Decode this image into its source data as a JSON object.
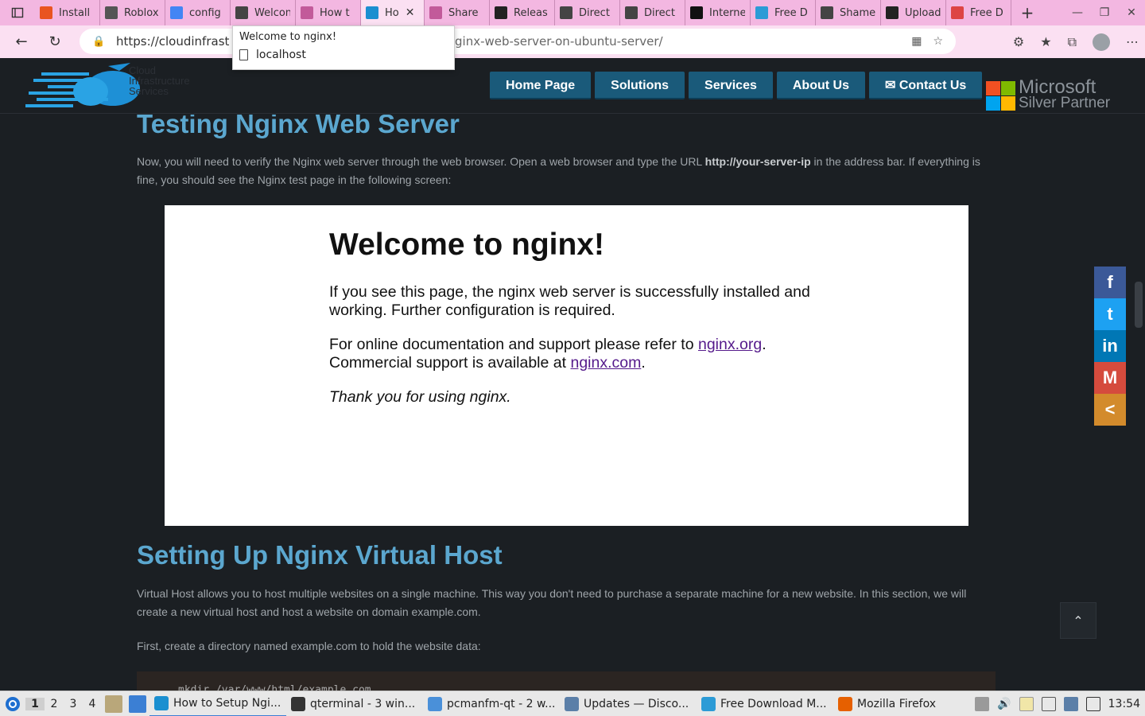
{
  "browser": {
    "tabs": [
      {
        "title": "Install",
        "icon": "ubuntu-icon",
        "color": "#e95420"
      },
      {
        "title": "Roblox",
        "icon": "roblox-icon",
        "color": "#555555"
      },
      {
        "title": "config",
        "icon": "google-icon",
        "color": "#4285f4"
      },
      {
        "title": "Welcon",
        "icon": "page-icon",
        "color": "#444444"
      },
      {
        "title": "How t",
        "icon": "site-icon",
        "color": "#c25a9a"
      },
      {
        "title": "Ho",
        "icon": "cloud-site-icon",
        "color": "#1a8fd0",
        "active": true
      },
      {
        "title": "Share",
        "icon": "site-icon",
        "color": "#c25a9a"
      },
      {
        "title": "Releas",
        "icon": "github-icon",
        "color": "#222222"
      },
      {
        "title": "Direct",
        "icon": "page-icon",
        "color": "#444444"
      },
      {
        "title": "Direct",
        "icon": "page-icon",
        "color": "#444444"
      },
      {
        "title": "Interne",
        "icon": "m-icon",
        "color": "#111111"
      },
      {
        "title": "Free D",
        "icon": "download-icon",
        "color": "#2c9bd6"
      },
      {
        "title": "Shame",
        "icon": "page-icon",
        "color": "#444444"
      },
      {
        "title": "Upload",
        "icon": "xfs-icon",
        "color": "#222222"
      },
      {
        "title": "Free D",
        "icon": "download2-icon",
        "color": "#d44"
      }
    ],
    "url_visible_start": "https://cloudinfrast",
    "url_visible_end": "ginx-web-server-on-ubuntu-server/",
    "hover_card": {
      "title": "Welcome to nginx!",
      "host": "localhost"
    }
  },
  "site": {
    "logo_text": [
      "Cloud",
      "Infrastructure",
      "Services"
    ],
    "menu": [
      "Home Page",
      "Solutions",
      "Services",
      "About Us",
      "Contact Us"
    ],
    "partner": {
      "line1": "Microsoft",
      "line2": "Silver Partner"
    }
  },
  "article": {
    "h_testing": "Testing Nginx Web Server",
    "p_testing_1": "Now, you will need to verify the Nginx web server through the web browser. Open a web browser and type the URL ",
    "p_testing_bold": "http://your-server-ip",
    "p_testing_2": " in the address bar. If everything is fine, you should see the Nginx test page in the following screen:",
    "nginx_page": {
      "title": "Welcome to nginx!",
      "p1": "If you see this page, the nginx web server is successfully installed and working. Further configuration is required.",
      "p2_a": "For online documentation and support please refer to ",
      "p2_link1": "nginx.org",
      "p2_b": ".",
      "p2_c": "Commercial support is available at ",
      "p2_link2": "nginx.com",
      "p2_d": ".",
      "p3": "Thank you for using nginx."
    },
    "h_vhost": "Setting Up Nginx Virtual Host",
    "p_vhost": "Virtual Host allows you to host multiple websites on a single machine. This way you don't need to purchase a separate machine for a new website. In this section, we will create a new virtual host and host a website on domain example.com.",
    "p_dir": "First, create a directory named example.com to hold the website data:",
    "code": "mkdir /var/www/html/example.com"
  },
  "social": [
    {
      "name": "facebook",
      "glyph": "f",
      "color": "#3b5998"
    },
    {
      "name": "twitter",
      "glyph": "t",
      "color": "#1da1f2"
    },
    {
      "name": "linkedin",
      "glyph": "in",
      "color": "#0077b5"
    },
    {
      "name": "gmail",
      "glyph": "M",
      "color": "#d54b3d"
    },
    {
      "name": "share",
      "glyph": "<",
      "color": "#d38b2c"
    }
  ],
  "taskbar": {
    "workspaces": [
      "1",
      "2",
      "3",
      "4"
    ],
    "tasks": [
      {
        "label": "How to Setup Ngi...",
        "color": "#1a8fd0",
        "active": true
      },
      {
        "label": "qterminal - 3 win...",
        "color": "#333333"
      },
      {
        "label": "pcmanfm-qt - 2 w...",
        "color": "#4a90d9"
      },
      {
        "label": "Updates — Disco...",
        "color": "#5b7fa8"
      },
      {
        "label": "Free Download M...",
        "color": "#2c9bd6"
      },
      {
        "label": "Mozilla Firefox",
        "color": "#e66000"
      }
    ],
    "clock": "13:54"
  }
}
